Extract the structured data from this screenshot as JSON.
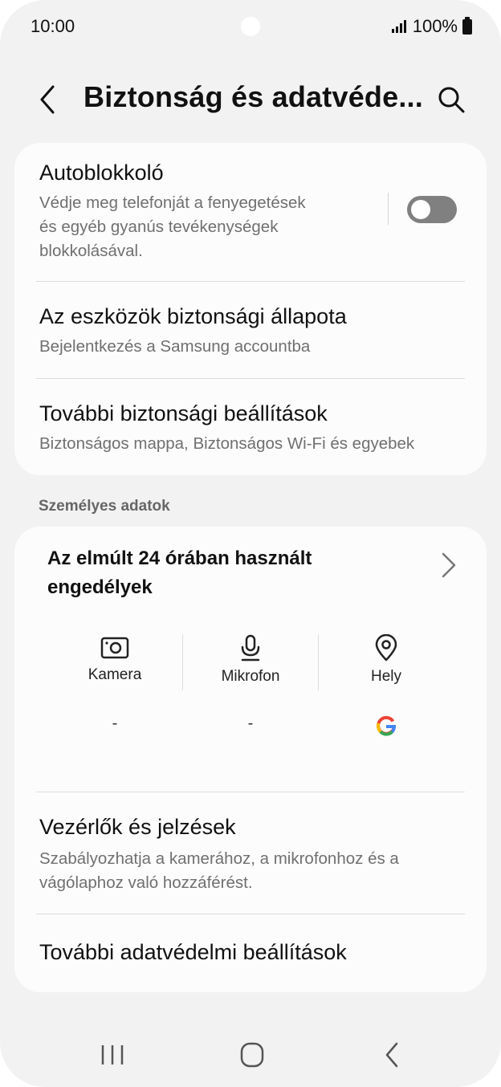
{
  "status_bar": {
    "time": "10:00",
    "battery_text": "100%"
  },
  "header": {
    "title": "Biztonság és adatvéde...",
    "back_icon": "chevron-left-icon",
    "search_icon": "search-icon"
  },
  "security_card": {
    "autoblocker": {
      "title": "Autoblokkoló",
      "subtitle_line1": "Védje meg telefonját a fenyegetések",
      "subtitle_line2": "és egyéb gyanús tevékenységek",
      "subtitle_line3": "blokkolásával.",
      "toggle_on": false
    },
    "device_security": {
      "title": "Az eszközök biztonsági állapota",
      "subtitle": "Bejelentkezés a Samsung accountba"
    },
    "more_security": {
      "title": "További biztonsági beállítások",
      "subtitle": "Biztonságos mappa, Biztonságos Wi-Fi és egyebek"
    }
  },
  "personal_section": {
    "label": "Személyes adatok"
  },
  "privacy_card": {
    "permissions": {
      "title_line1": "Az elmúlt 24 órában használt",
      "title_line2": "engedélyek",
      "columns": [
        {
          "label": "Kamera",
          "icon": "camera-icon",
          "value": "-"
        },
        {
          "label": "Mikrofon",
          "icon": "microphone-icon",
          "value": "-"
        },
        {
          "label": "Hely",
          "icon": "location-icon",
          "value": "google-icon"
        }
      ]
    },
    "controls": {
      "title": "Vezérlők és jelzések",
      "subtitle_line1": "Szabályozhatja a kamerához, a mikrofonhoz és a",
      "subtitle_line2": "vágólaphoz való hozzáférést."
    },
    "more_privacy": {
      "title": "További adatvédelmi beállítások"
    }
  },
  "nav_bar": {
    "recents_icon": "recents-icon",
    "home_icon": "home-icon",
    "back_icon": "back-icon"
  },
  "colors": {
    "background": "#f2f2f2",
    "card": "#fcfcfc",
    "toggle_off": "#808080"
  }
}
